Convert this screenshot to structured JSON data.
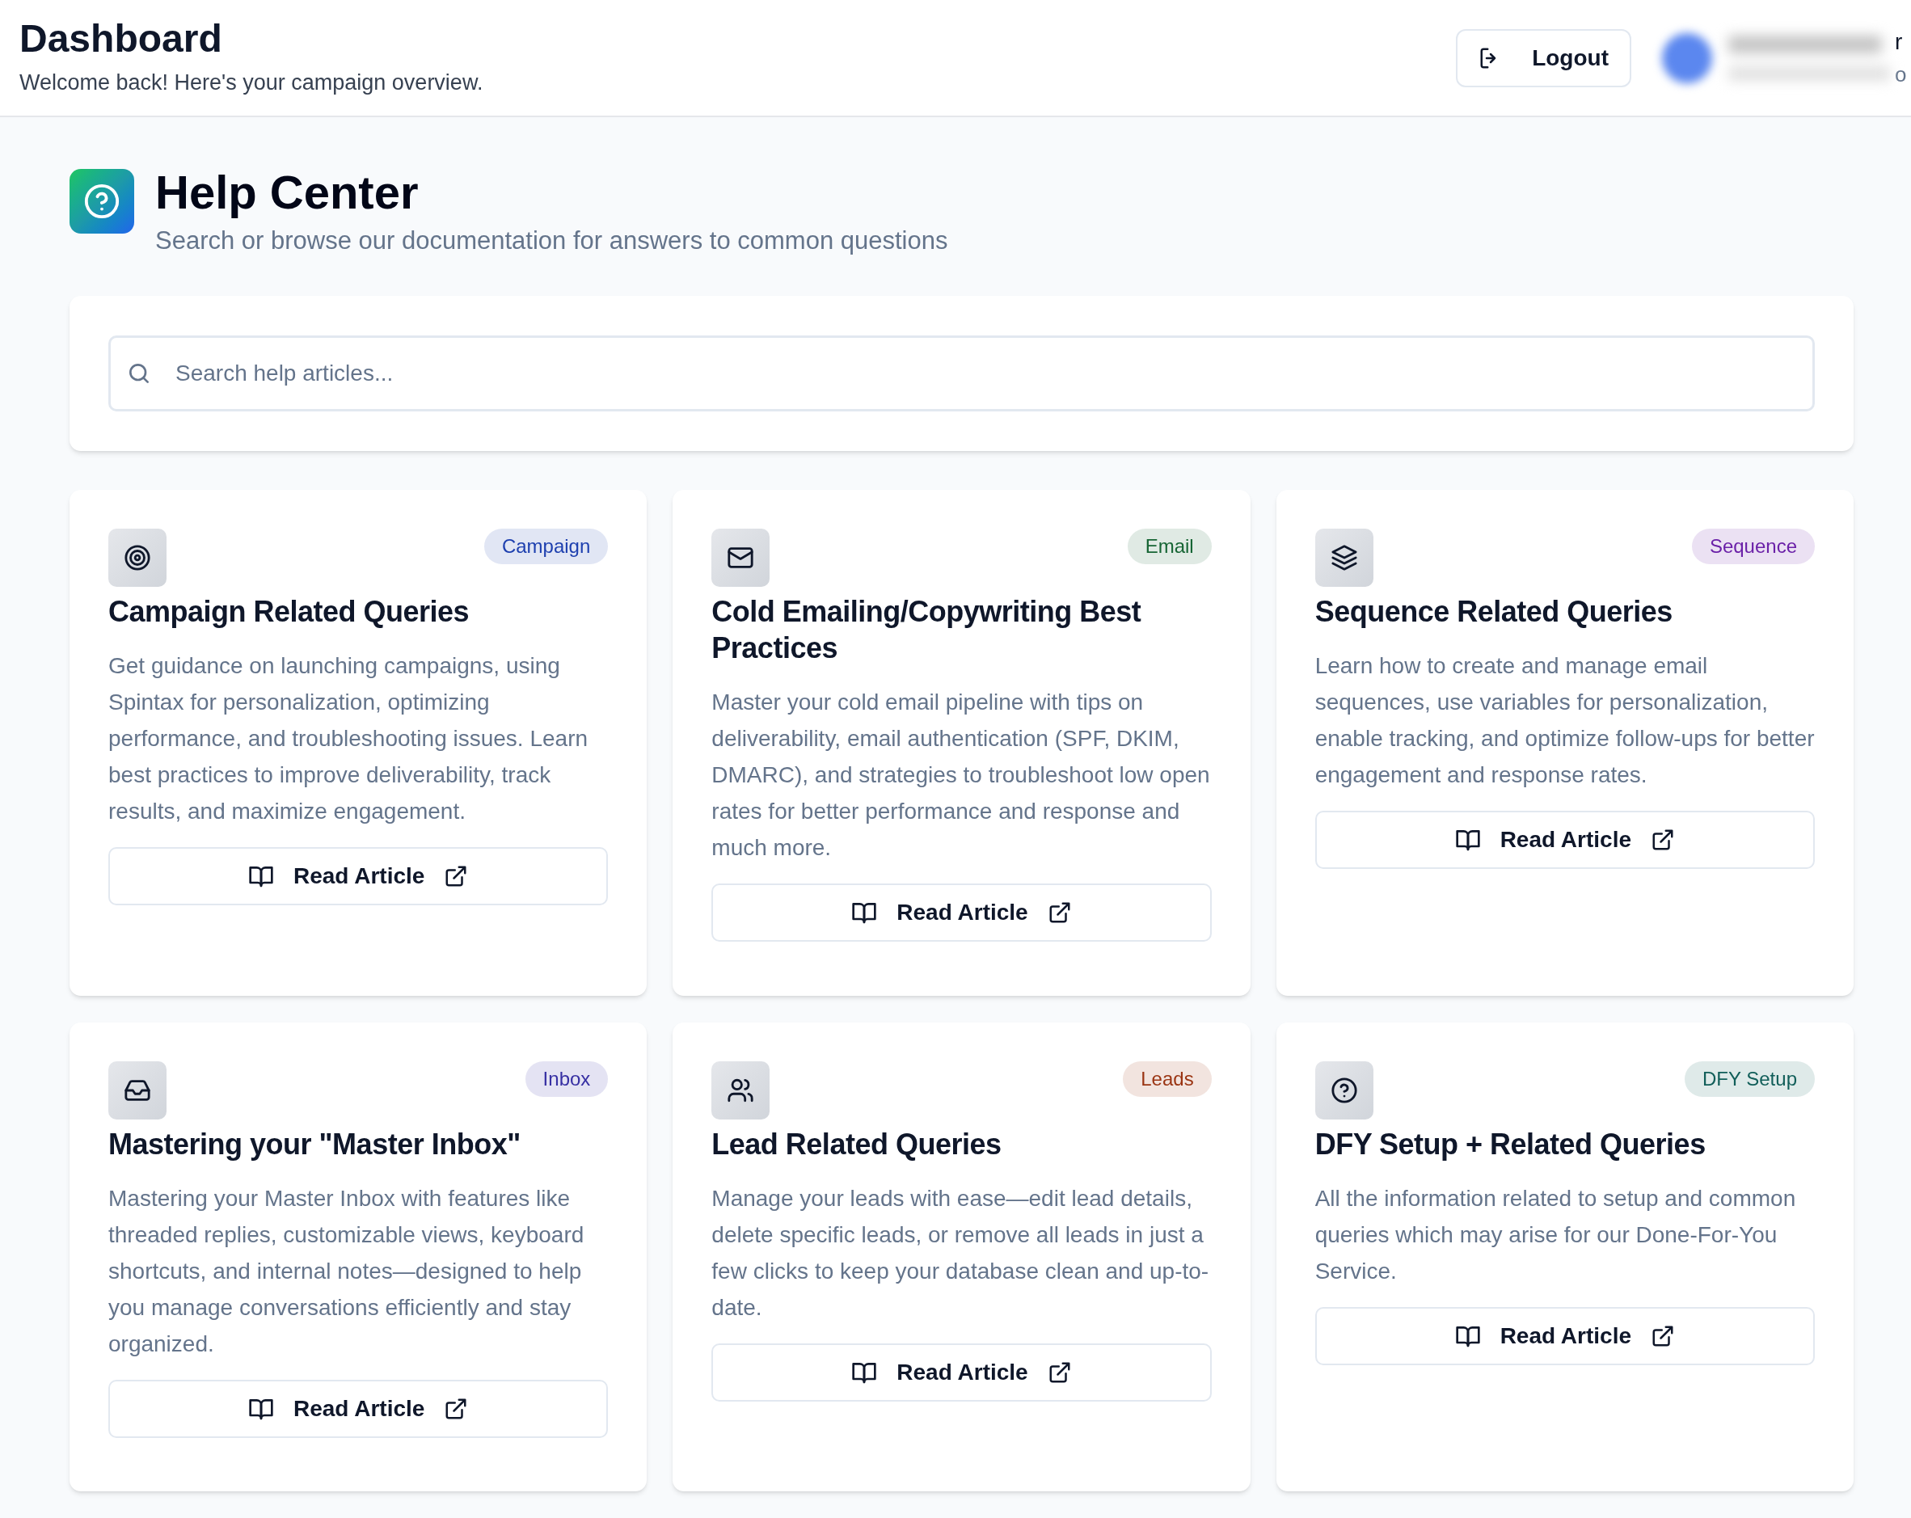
{
  "header": {
    "title": "Dashboard",
    "subtitle": "Welcome back! Here's your campaign overview.",
    "logout": "Logout",
    "user": {
      "name_visible": "r",
      "email_visible": "o"
    }
  },
  "help_center": {
    "title": "Help Center",
    "subtitle": "Search or browse our documentation for answers to common questions"
  },
  "search": {
    "placeholder": "Search help articles..."
  },
  "articles": [
    {
      "kind": "target",
      "badge": "Campaign",
      "color": "#1e40af",
      "title": "Campaign Related Queries",
      "description": "Get guidance on launching campaigns, using Spintax for personalization, optimizing performance, and troubleshooting issues. Learn best practices to improve deliverability, track results, and maximize engagement.",
      "button": "Read Article"
    },
    {
      "kind": "mail",
      "badge": "Email",
      "color": "#166534",
      "title": "Cold Emailing/Copywriting Best Practices",
      "description": "Master your cold email pipeline with tips on deliverability, email authentication (SPF, DKIM, DMARC), and strategies to troubleshoot low open rates for better performance and response and much more.",
      "button": "Read Article"
    },
    {
      "kind": "layers",
      "badge": "Sequence",
      "color": "#6b21a8",
      "title": "Sequence Related Queries",
      "description": "Learn how to create and manage email sequences, use variables for personalization, enable tracking, and optimize follow-ups for better engagement and response rates.",
      "button": "Read Article"
    },
    {
      "kind": "inbox",
      "badge": "Inbox",
      "color": "#3730a3",
      "title": "Mastering your \"Master Inbox\"",
      "description": "Mastering your Master Inbox with features like threaded replies, customizable views, keyboard shortcuts, and internal notes—designed to help you manage conversations efficiently and stay organized.",
      "button": "Read Article"
    },
    {
      "kind": "users",
      "badge": "Leads",
      "color": "#9a3412",
      "title": "Lead Related Queries",
      "description": "Manage your leads with ease—edit lead details, delete specific leads, or remove all leads in just a few clicks to keep your database clean and up-to-date.",
      "button": "Read Article"
    },
    {
      "kind": "help",
      "badge": "DFY Setup",
      "color": "#115e59",
      "title": "DFY Setup + Related Queries",
      "description": "All the information related to setup and common queries which may arise for our Done-For-You Service.",
      "button": "Read Article"
    }
  ]
}
